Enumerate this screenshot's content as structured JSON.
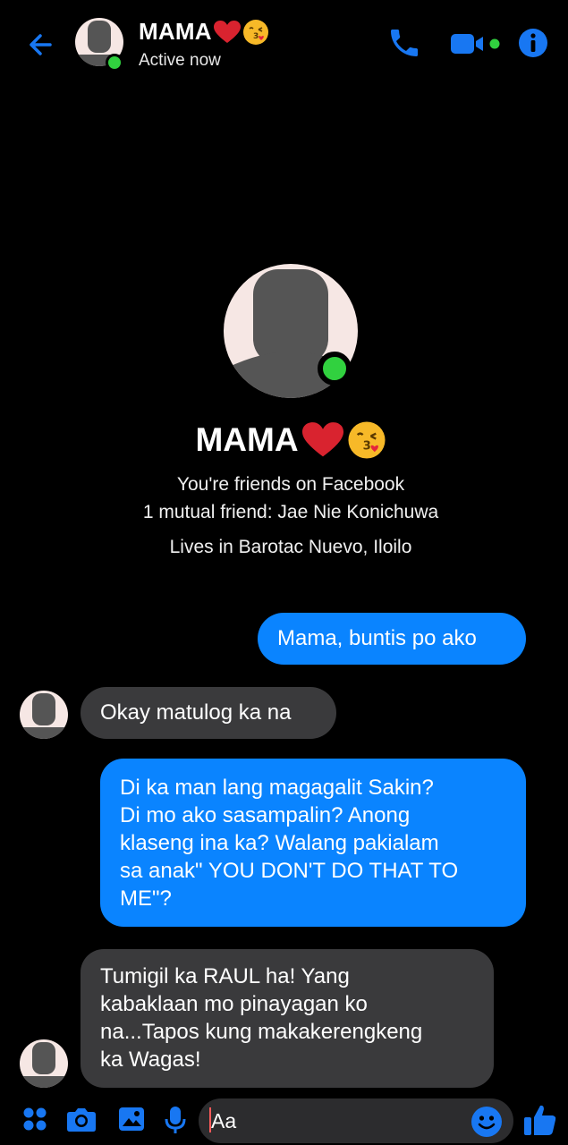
{
  "header": {
    "name": "MAMA",
    "status": "Active now",
    "icons": [
      "back-arrow-icon",
      "phone-icon",
      "video-camera-icon",
      "info-icon"
    ]
  },
  "profile": {
    "name": "MAMA",
    "friends_text": "You're friends on Facebook",
    "mutual_text": "1 mutual friend: Jae Nie Konichuwa",
    "lives_text": "Lives in Barotac Nuevo, Iloilo"
  },
  "messages": [
    {
      "direction": "outgoing",
      "text": "Mama, buntis po ako"
    },
    {
      "direction": "incoming",
      "text": "Okay matulog ka na"
    },
    {
      "direction": "outgoing",
      "lines": [
        "Di ka man lang magagalit Sakin?",
        "Di mo ako sasampalin? Anong",
        "klaseng ina ka? Walang pakialam",
        "sa anak\" YOU DON'T DO THAT TO",
        "ME\"?"
      ]
    },
    {
      "direction": "incoming",
      "lines": [
        "Tumigil ka RAUL ha! Yang",
        "kabaklaan mo pinayagan ko",
        "na...Tapos kung makakerengkeng",
        "ka Wagas!"
      ]
    }
  ],
  "composer": {
    "placeholder": "Aa",
    "icons": [
      "apps-grid-icon",
      "camera-icon",
      "gallery-icon",
      "microphone-icon",
      "emoji-icon",
      "thumbs-up-icon"
    ]
  },
  "colors": {
    "accent": "#0a84ff",
    "incoming_bubble": "#3a3a3c",
    "online": "#31d13f",
    "background": "#000000"
  }
}
